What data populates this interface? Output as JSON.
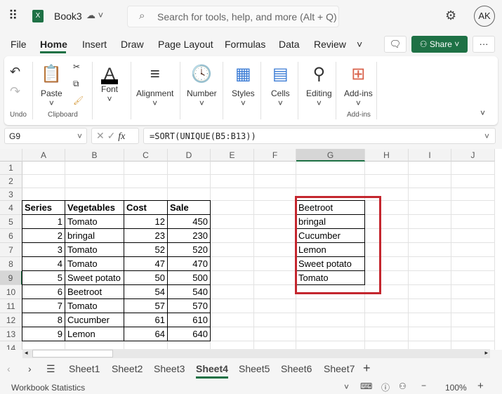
{
  "app": {
    "file_name": "Book3",
    "search_placeholder": "Search for tools, help, and more (Alt + Q)",
    "avatar": "AK",
    "share": "Share"
  },
  "menu": [
    "File",
    "Home",
    "Insert",
    "Draw",
    "Page Layout",
    "Formulas",
    "Data",
    "Review"
  ],
  "ribbon": {
    "undo_group": "Undo",
    "paste": "Paste",
    "clipboard_group": "Clipboard",
    "font": "Font",
    "alignment": "Alignment",
    "number": "Number",
    "styles": "Styles",
    "cells": "Cells",
    "editing": "Editing",
    "addins": "Add-ins",
    "addins_group": "Add-ins"
  },
  "formula_bar": {
    "name_box": "G9",
    "fx": "fx",
    "formula": "=SORT(UNIQUE(B5:B13))"
  },
  "columns": [
    "A",
    "B",
    "C",
    "D",
    "E",
    "F",
    "G",
    "H",
    "I",
    "J"
  ],
  "rows": [
    "1",
    "2",
    "3",
    "4",
    "5",
    "6",
    "7",
    "8",
    "9",
    "10",
    "11",
    "12",
    "13",
    "14"
  ],
  "table": {
    "headers": [
      "Series",
      "Vegetables",
      "Cost",
      "Sale"
    ],
    "rows": [
      [
        "1",
        "Tomato",
        "12",
        "450"
      ],
      [
        "2",
        "bringal",
        "23",
        "230"
      ],
      [
        "3",
        "Tomato",
        "52",
        "520"
      ],
      [
        "4",
        "Tomato",
        "47",
        "470"
      ],
      [
        "5",
        "Sweet potato",
        "50",
        "500"
      ],
      [
        "6",
        "Beetroot",
        "54",
        "540"
      ],
      [
        "7",
        "Tomato",
        "57",
        "570"
      ],
      [
        "8",
        "Cucumber",
        "61",
        "610"
      ],
      [
        "9",
        "Lemon",
        "64",
        "640"
      ]
    ]
  },
  "result": [
    "Beetroot",
    "bringal",
    "Cucumber",
    "Lemon",
    "Sweet potato",
    "Tomato"
  ],
  "sheets": [
    "Sheet1",
    "Sheet2",
    "Sheet3",
    "Sheet4",
    "Sheet5",
    "Sheet6",
    "Sheet7"
  ],
  "active_sheet": "Sheet4",
  "status": {
    "left": "Workbook Statistics",
    "zoom": "100%"
  },
  "colors": {
    "accent": "#1e7145",
    "highlight": "#c4262e"
  }
}
